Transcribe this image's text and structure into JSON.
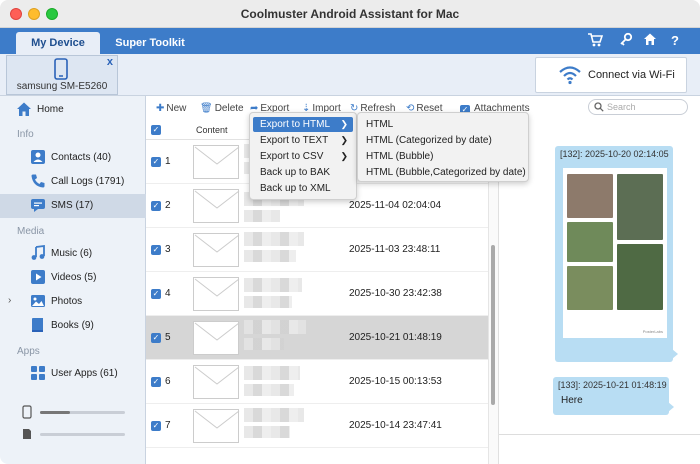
{
  "window": {
    "title": "Coolmuster Android Assistant for Mac"
  },
  "nav": {
    "tabs": [
      {
        "label": "My Device",
        "active": true
      },
      {
        "label": "Super Toolkit",
        "active": false
      }
    ],
    "icons": [
      "cart-icon",
      "key-icon",
      "home-icon",
      "help-icon"
    ]
  },
  "device": {
    "name": "samsung SM-E5260",
    "close_label": "x"
  },
  "wifi_button": {
    "label": "Connect via Wi-Fi"
  },
  "sidebar": {
    "home_label": "Home",
    "sections": {
      "info": "Info",
      "media": "Media",
      "apps": "Apps"
    },
    "info_items": [
      {
        "label": "Contacts (40)",
        "icon": "contacts-icon"
      },
      {
        "label": "Call Logs (1791)",
        "icon": "phone-icon"
      },
      {
        "label": "SMS (17)",
        "icon": "sms-icon",
        "active": true
      }
    ],
    "media_items": [
      {
        "label": "Music (6)",
        "icon": "music-icon"
      },
      {
        "label": "Videos (5)",
        "icon": "video-icon"
      },
      {
        "label": "Photos",
        "icon": "photo-icon"
      },
      {
        "label": "Books (9)",
        "icon": "book-icon"
      }
    ],
    "apps_items": [
      {
        "label": "User Apps (61)",
        "icon": "apps-icon"
      }
    ],
    "storage": [
      {
        "kind": "phone",
        "used_fraction": 0.35
      },
      {
        "kind": "sdcard",
        "used_fraction": 0.0
      }
    ]
  },
  "toolbar": {
    "new_label": "New",
    "delete_label": "Delete",
    "export_label": "Export",
    "import_label": "Import",
    "refresh_label": "Refresh",
    "reset_label": "Reset",
    "attachments_label": "Attachments",
    "search_placeholder": "Search"
  },
  "list": {
    "content_header": "Content",
    "rows": [
      {
        "num": "1",
        "date": ""
      },
      {
        "num": "2",
        "date": "2025-11-04 02:04:04"
      },
      {
        "num": "3",
        "date": "2025-11-03 23:48:11"
      },
      {
        "num": "4",
        "date": "2025-10-30 23:42:38"
      },
      {
        "num": "5",
        "date": "2025-10-21 01:48:19",
        "selected": true
      },
      {
        "num": "6",
        "date": "2025-10-15 00:13:53"
      },
      {
        "num": "7",
        "date": "2025-10-14 23:47:41"
      }
    ]
  },
  "export_menu": {
    "items": [
      {
        "label": "Export to HTML",
        "submenu": true,
        "highlighted": true
      },
      {
        "label": "Export to TEXT",
        "submenu": true
      },
      {
        "label": "Export to CSV",
        "submenu": true
      },
      {
        "label": "Back up to BAK",
        "submenu": false
      },
      {
        "label": "Back up to XML",
        "submenu": false
      }
    ],
    "submenu_items": [
      "HTML",
      "HTML (Categorized by date)",
      "HTML (Bubble)",
      "HTML (Bubble,Categorized by date)"
    ]
  },
  "preview": {
    "messages": [
      {
        "time": "[132]: 2025-10-20 02:14:05",
        "text": ""
      },
      {
        "time": "[133]: 2025-10-21 01:48:19",
        "text": "Here"
      }
    ],
    "photo_caption": "PosterLabs"
  },
  "colors": {
    "accent": "#3d7cc9",
    "bubble": "#b8ddf3",
    "sidebar_bg": "#edf2f8"
  }
}
